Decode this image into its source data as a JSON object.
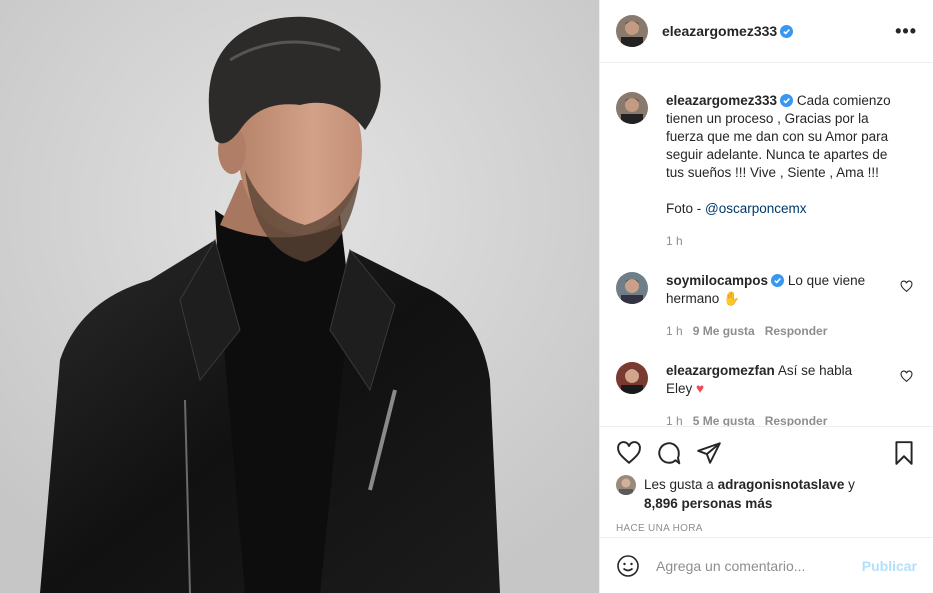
{
  "post": {
    "author": "eleazargomez333",
    "verified": true,
    "photo_alt": "Hombre con chaqueta de cuero negra y suéter de cuello alto"
  },
  "caption": {
    "username": "eleazargomez333",
    "text": "Cada comienzo tienen un proceso , Gracias por la fuerza que me dan con su Amor para seguir adelante. Nunca te apartes de tus sueños !!! Vive , Siente , Ama !!!",
    "foto_prefix": "Foto - ",
    "foto_mention": "@oscarponcemx",
    "time": "1 h"
  },
  "comments": [
    {
      "username": "soymilocampos",
      "verified": true,
      "text": "Lo que viene hermano",
      "emoji": "✋",
      "time": "1 h",
      "likes": "9 Me gusta",
      "reply": "Responder"
    },
    {
      "username": "eleazargomezfan",
      "verified": false,
      "text": "Así se habla Eley",
      "emoji": "♥",
      "time": "1 h",
      "likes": "5 Me gusta",
      "reply": "Responder"
    }
  ],
  "likes": {
    "prefix": "Les gusta a ",
    "user": "adragonisnotaslave",
    "middle": " y",
    "count": "8,896 personas más"
  },
  "time_ago": "HACE UNA HORA",
  "add_comment": {
    "placeholder": "Agrega un comentario...",
    "publish_label": "Publicar"
  },
  "colors": {
    "verified": "#3897f0",
    "publish": "#b2dffc",
    "heart": "#ed4956",
    "mention": "#00376b"
  }
}
